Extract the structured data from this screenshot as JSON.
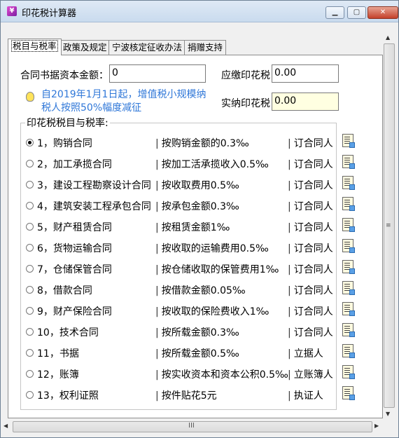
{
  "window": {
    "title": "印花税计算器",
    "app_icon_glyph": "¥",
    "min_glyph": "▁",
    "max_glyph": "▢",
    "close_glyph": "✕"
  },
  "tabs": [
    {
      "label": "税目与税率",
      "active": true
    },
    {
      "label": "政策及规定",
      "active": false
    },
    {
      "label": "宁波核定征收办法",
      "active": false
    },
    {
      "label": "捐赠支持",
      "active": false
    }
  ],
  "form": {
    "amount_label": "合同书据资本金额：",
    "amount_value": "0",
    "payable_label": "应缴印花税",
    "payable_value": "0.00",
    "actual_label": "实纳印花税",
    "actual_value": "0.00"
  },
  "notice": {
    "text": "自2019年1月1日起，增值税小规模纳税人按照50%幅度减征",
    "icon": "lightbulb-icon"
  },
  "rates_group": {
    "legend": "印花税税目与税率:",
    "rows": [
      {
        "name": "1，购销合同",
        "basis": "按购销金额的0.3‰",
        "party": "订合同人",
        "selected": true
      },
      {
        "name": "2，加工承揽合同",
        "basis": "按加工活承揽收入0.5‰",
        "party": "订合同人",
        "selected": false
      },
      {
        "name": "3，建设工程勘察设计合同",
        "basis": "按收取费用0.5‰",
        "party": "订合同人",
        "selected": false
      },
      {
        "name": "4，建筑安装工程承包合同",
        "basis": "按承包金额0.3‰",
        "party": "订合同人",
        "selected": false
      },
      {
        "name": "5，财产租赁合同",
        "basis": "按租赁金额1‰",
        "party": "订合同人",
        "selected": false
      },
      {
        "name": "6，货物运输合同",
        "basis": "按收取的运输费用0.5‰",
        "party": "订合同人",
        "selected": false
      },
      {
        "name": "7，仓储保管合同",
        "basis": "按仓储收取的保管费用1‰",
        "party": "订合同人",
        "selected": false
      },
      {
        "name": "8，借款合同",
        "basis": "按借款金额0.05‰",
        "party": "订合同人",
        "selected": false
      },
      {
        "name": "9，财产保险合同",
        "basis": "按收取的保险费收入1‰",
        "party": "订合同人",
        "selected": false
      },
      {
        "name": "10，技术合同",
        "basis": "按所载金额0.3‰",
        "party": "订合同人",
        "selected": false
      },
      {
        "name": "11，书据",
        "basis": "按所载金额0.5‰",
        "party": "立据人",
        "selected": false
      },
      {
        "name": "12，账簿",
        "basis": "按实收资本和资本公积0.5‰",
        "party": "立账簿人",
        "selected": false
      },
      {
        "name": "13，权利证照",
        "basis": "按件贴花5元",
        "party": "执证人",
        "selected": false
      }
    ]
  },
  "scrollbars": {
    "up": "▲",
    "down": "▼",
    "left": "◀",
    "right": "▶",
    "grip_v": "≡",
    "grip_h": "III"
  }
}
